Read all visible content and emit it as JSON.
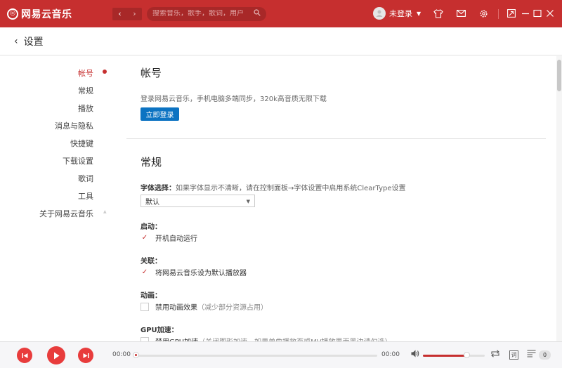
{
  "titlebar": {
    "logo_text": "网易云音乐",
    "logo_glyph": "◎",
    "nav_back": "‹",
    "nav_forward": "›",
    "search_placeholder": "搜索音乐，歌手，歌词，用户",
    "login_text": "未登录",
    "icons": [
      "shirt-icon",
      "mail-icon",
      "gear-icon",
      "mini-mode-icon",
      "minimize-icon",
      "maximize-icon",
      "close-icon"
    ]
  },
  "header": {
    "back_arrow": "‹",
    "title": "设置"
  },
  "leftnav": {
    "items": [
      "帐号",
      "常规",
      "播放",
      "消息与隐私",
      "快捷键",
      "下载设置",
      "歌词",
      "工具",
      "关于网易云音乐"
    ]
  },
  "account": {
    "title": "帐号",
    "desc": "登录网易云音乐，手机电脑多端同步，320k高音质无限下载",
    "login_button": "立即登录"
  },
  "general": {
    "title": "常规",
    "font_label": "字体选择：",
    "font_note": "如果字体显示不清晰，请在控制面板→字体设置中启用系统ClearType设置",
    "font_value": "默认",
    "startup_label": "启动：",
    "startup_option": "开机自动运行",
    "association_label": "关联：",
    "association_option": "将网易云音乐设为默认播放器",
    "animation_label": "动画：",
    "animation_option": "禁用动画效果",
    "animation_note": "（减少部分资源占用）",
    "gpu_label": "GPU加速：",
    "gpu_option": "禁用GPU加速",
    "gpu_note": "（关闭图形加速，如果单曲播放页或MV播放界面黑边请勾选）"
  },
  "player": {
    "time_current": "00:00",
    "time_total": "00:00",
    "progress": 0,
    "volume": 0.7,
    "playlist_count": "0",
    "lyric_label": "词"
  },
  "colors": {
    "brand_red": "#c62f2f",
    "button_blue": "#0c73c2",
    "player_red": "#e83c3c"
  }
}
